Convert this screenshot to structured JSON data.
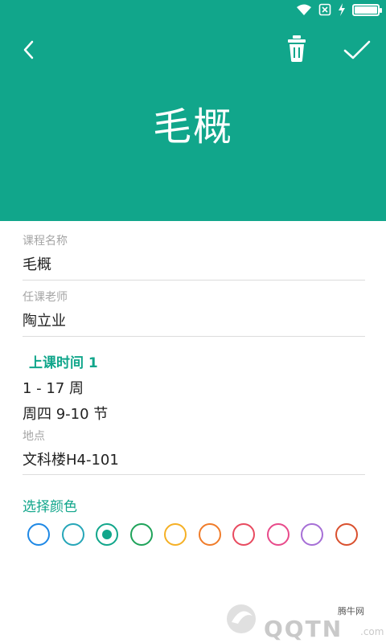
{
  "colors": {
    "accent": "#11a68b",
    "header_bg": "#11a68b",
    "label": "#a5a5a5",
    "text": "#222222"
  },
  "status_bar": {
    "icons": [
      "wifi-icon",
      "no-sim-icon",
      "charging-icon",
      "battery-icon"
    ],
    "battery_level": 1.0
  },
  "toolbar": {
    "back_icon": "chevron-left-icon",
    "delete_icon": "trash-icon",
    "confirm_icon": "check-icon"
  },
  "course": {
    "title": "毛概",
    "name_label": "课程名称",
    "name_value": "毛概",
    "teacher_label": "任课老师",
    "teacher_value": "陶立业"
  },
  "schedule": {
    "section_title": "上课时间 1",
    "weeks": "1 - 17 周",
    "periods": "周四 9-10 节",
    "location_label": "地点",
    "location_value": "文科楼H4-101"
  },
  "color_picker": {
    "title": "选择颜色",
    "selected_index": 2,
    "options": [
      "#1e88e5",
      "#26a6b8",
      "#11a68b",
      "#1fa35a",
      "#f5b025",
      "#f07c2a",
      "#e84a5f",
      "#e84a8a",
      "#a66fd6",
      "#d9502e"
    ]
  },
  "watermark": {
    "site_label": "腾牛网",
    "logo_text": "QQTN",
    "logo_suffix": ".com"
  }
}
